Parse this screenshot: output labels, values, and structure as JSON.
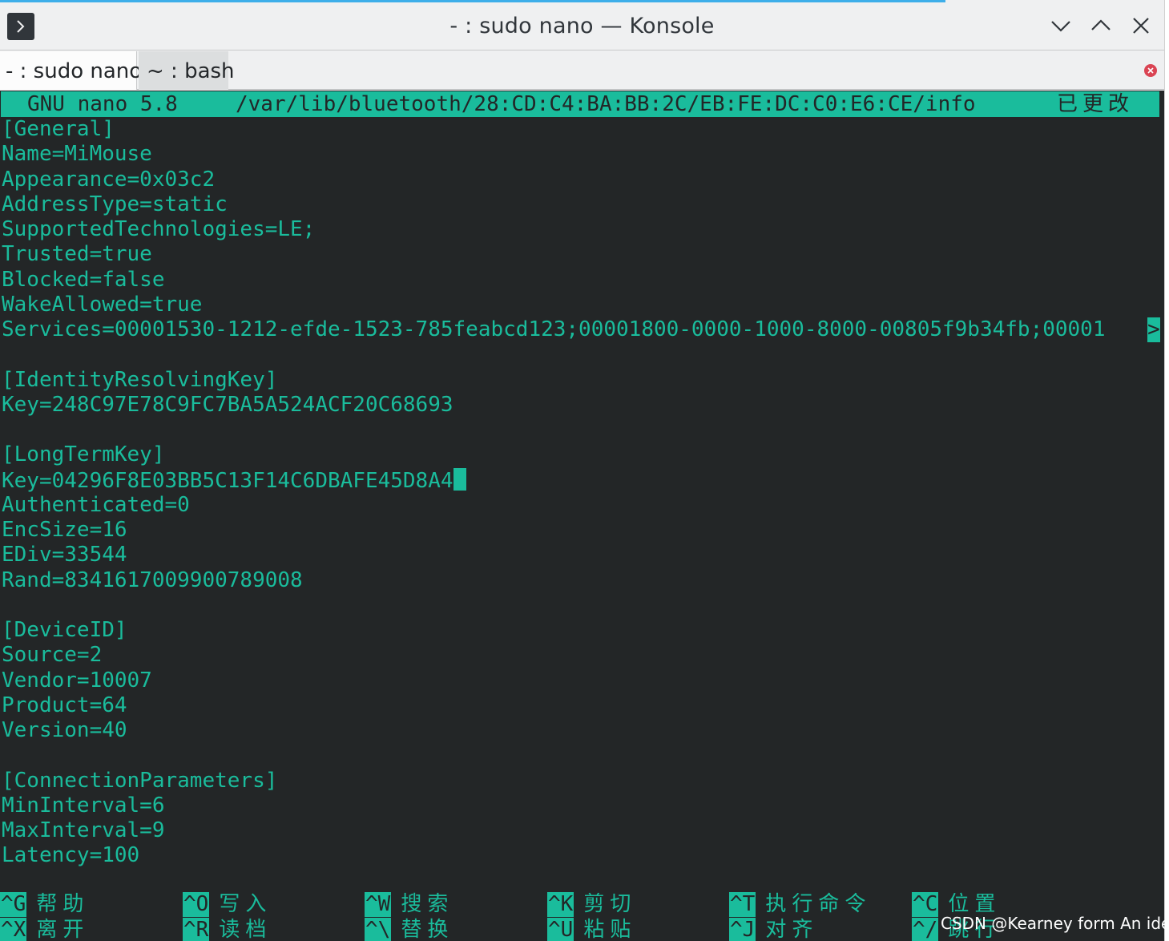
{
  "window": {
    "title": "- : sudo nano — Konsole"
  },
  "tabs": [
    {
      "label": "- : sudo nano",
      "active": true
    },
    {
      "label": "~ : bash",
      "active": false
    }
  ],
  "nano": {
    "program": "GNU nano 5.8",
    "path": "/var/lib/bluetooth/28:CD:C4:BA:BB:2C/EB:FE:DC:C0:E6:CE/info",
    "status": "已更改"
  },
  "lines": [
    "[General]",
    "Name=MiMouse",
    "Appearance=0x03c2",
    "AddressType=static",
    "SupportedTechnologies=LE;",
    "Trusted=true",
    "Blocked=false",
    "WakeAllowed=true",
    "Services=00001530-1212-efde-1523-785feabcd123;00001800-0000-1000-8000-00805f9b34fb;00001",
    "",
    "[IdentityResolvingKey]",
    "Key=248C97E78C9FC7BA5A524ACF20C68693",
    "",
    "[LongTermKey]",
    "Key=04296F8E03BB5C13F14C6DBAFE45D8A4",
    "Authenticated=0",
    "EncSize=16",
    "EDiv=33544",
    "Rand=8341617009900789008",
    "",
    "[DeviceID]",
    "Source=2",
    "Vendor=10007",
    "Product=64",
    "Version=40",
    "",
    "[ConnectionParameters]",
    "MinInterval=6",
    "MaxInterval=9",
    "Latency=100"
  ],
  "overflow_marker": ">",
  "shortcuts": [
    {
      "key": "^G",
      "label": "帮助"
    },
    {
      "key": "^O",
      "label": "写入"
    },
    {
      "key": "^W",
      "label": "搜索"
    },
    {
      "key": "^K",
      "label": "剪切"
    },
    {
      "key": "^T",
      "label": "执行命令"
    },
    {
      "key": "^C",
      "label": "位置"
    },
    {
      "key": "^X",
      "label": "离开"
    },
    {
      "key": "^R",
      "label": "读档"
    },
    {
      "key": "^\\",
      "label": "替换"
    },
    {
      "key": "^U",
      "label": "粘贴"
    },
    {
      "key": "^J",
      "label": "对齐"
    },
    {
      "key": "^/",
      "label": "跳行"
    }
  ],
  "watermark": "CSDN @Kearney form An idea",
  "colors": {
    "terminal_bg": "#232627",
    "nano_accent": "#1abc9c",
    "window_frame": "#eff0f1"
  },
  "icons": [
    "terminal-app-icon",
    "minimize-icon",
    "maximize-icon",
    "close-icon",
    "tab-close-icon"
  ]
}
